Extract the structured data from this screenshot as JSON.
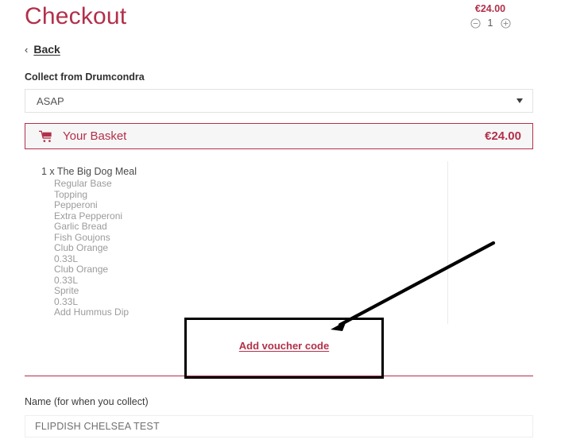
{
  "page": {
    "title": "Checkout",
    "back": {
      "label": "Back",
      "icon": "chevron-left-icon"
    }
  },
  "collect": {
    "label": "Collect from Drumcondra",
    "select": {
      "value": "ASAP",
      "icon": "chevron-down-icon"
    }
  },
  "basket": {
    "icon": "shopping-cart-icon",
    "title": "Your Basket",
    "total": "€24.00",
    "item": {
      "title": "1 x The Big Dog Meal",
      "options": [
        "Regular Base",
        "Topping",
        "Pepperoni",
        "Extra Pepperoni",
        "Garlic Bread",
        "Fish Goujons",
        "Club Orange",
        "0.33L",
        "Club Orange",
        "0.33L",
        "Sprite",
        "0.33L",
        "Add Hummus Dip"
      ],
      "price": "€24.00",
      "quantity": "1",
      "decrease_icon": "circle-minus-icon",
      "increase_icon": "circle-plus-icon"
    }
  },
  "voucher": {
    "link_label": "Add voucher code"
  },
  "name_field": {
    "label": "Name (for when you collect)",
    "value": "FLIPDISH CHELSEA TEST"
  },
  "annotation": {
    "highlight_target": "Add voucher code",
    "arrow_icon": "arrow-pointer-icon"
  },
  "colors": {
    "brand": "#b2304a",
    "annotation": "#000000",
    "muted_text": "#9b9b9b"
  }
}
